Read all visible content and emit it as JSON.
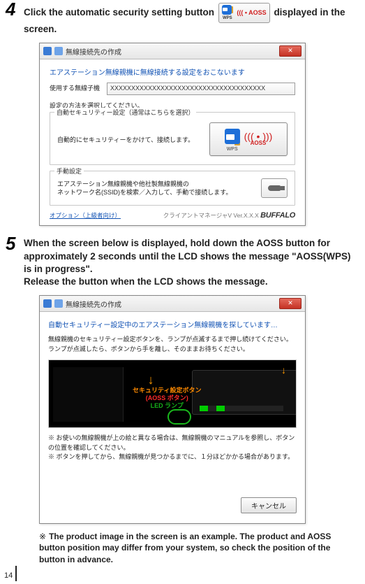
{
  "step4": {
    "num": "4",
    "text_before": "Click the automatic security setting button",
    "text_after": "displayed in the screen.",
    "inline_btn": {
      "wps_label": "WPS",
      "aoss_label": "AOSS",
      "wave": "((( •"
    }
  },
  "dialog1": {
    "title": "無線接続先の作成",
    "heading": "エアステーション無線親機に無線接続する設定をおこないます",
    "device_label": "使用する無線子機",
    "device_value": "XXXXXXXXXXXXXXXXXXXXXXXXXXXXXXXXXXXXX",
    "method_label": "設定の方法を選択してください。",
    "auto_group_title": "自動セキュリティー設定（通常はこちらを選択）",
    "auto_text": "自動的にセキュリティーをかけて、接続します。",
    "big_btn": {
      "wps_label": "WPS",
      "aoss_label": "AOSS",
      "wave": "((( • )))"
    },
    "manual_group_title": "手動設定",
    "manual_text_l1": "エアステーション無線親機や他社製無線親機の",
    "manual_text_l2": "ネットワーク名(SSID)を検索／入力して、手動で接続します。",
    "option_link": "オプション（上級者向け）",
    "client_ver": "クライアントマネージャV  Ver.X.X.X",
    "brand": "BUFFALO"
  },
  "step5": {
    "num": "5",
    "text": "When the screen below is displayed, hold down the AOSS button for approximately 2 seconds until the LCD shows the message \"AOSS(WPS) is in progress\".\nRelease the button when the LCD shows the message."
  },
  "dialog2": {
    "title": "無線接続先の作成",
    "heading": "自動セキュリティー設定中のエアステーション無線親機を探しています…",
    "instr_l1": "無線親機のセキュリティー設定ボタンを、ランプが点滅するまで押し続けてください。",
    "instr_l2": "ランプが点滅したら、ボタンから手を離し、そのままお待ちください。",
    "callout_l1": "セキュリティ設定ボタン",
    "callout_l2": "(AOSS ボタン)",
    "callout_l3": "LED ランプ",
    "note1": "※  お使いの無線親機が上の絵と異なる場合は、無線親機のマニュアルを参照し、ボタンの位置を確認してください。",
    "note2": "※  ボタンを押してから、無線親機が見つかるまでに、１分ほどかかる場合があります。",
    "cancel": "キャンセル"
  },
  "post_note": {
    "mark": "※",
    "text": "The product image in the screen is an example. The product and AOSS button position may differ from your system, so check the position of the button in advance."
  },
  "page_number": "14"
}
